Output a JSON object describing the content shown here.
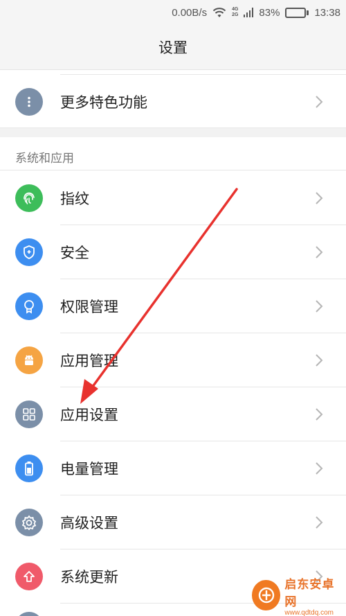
{
  "status_bar": {
    "net_speed": "0.00B/s",
    "net_tag_top": "4G",
    "net_tag_bottom": "2G",
    "battery_percent": "83%",
    "battery_level": 0.83,
    "time": "13:38"
  },
  "header": {
    "title": "设置"
  },
  "top_rows": [
    {
      "label": "更多特色功能",
      "icon": "more-dots-icon",
      "color": "#7b8fa8"
    }
  ],
  "section": {
    "header": "系统和应用"
  },
  "rows": [
    {
      "label": "指纹",
      "icon": "fingerprint-icon",
      "color": "#3dbd5a"
    },
    {
      "label": "安全",
      "icon": "shield-icon",
      "color": "#3d8ef0"
    },
    {
      "label": "权限管理",
      "icon": "badge-icon",
      "color": "#3d8ef0"
    },
    {
      "label": "应用管理",
      "icon": "android-icon",
      "color": "#f5a443"
    },
    {
      "label": "应用设置",
      "icon": "grid-icon",
      "color": "#7b8fa8"
    },
    {
      "label": "电量管理",
      "icon": "battery-icon",
      "color": "#3d8ef0"
    },
    {
      "label": "高级设置",
      "icon": "gear-icon",
      "color": "#7b8fa8"
    },
    {
      "label": "系统更新",
      "icon": "arrow-up-icon",
      "color": "#f05a6a"
    }
  ],
  "annotation": {
    "arrow_color": "#e8322e"
  },
  "watermark": {
    "name": "启东安卓网",
    "url": "www.qdtdq.com"
  }
}
